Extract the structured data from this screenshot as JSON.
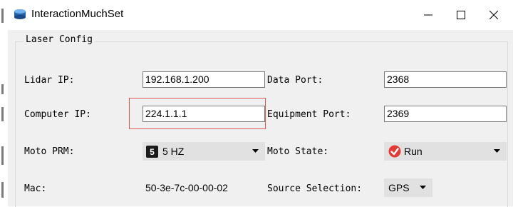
{
  "window": {
    "title": "InteractionMuchSet",
    "controls": [
      "minimize",
      "maximize",
      "close"
    ]
  },
  "group": {
    "title": "Laser Config"
  },
  "fields": {
    "lidar_ip": {
      "label": "Lidar IP:",
      "value": "192.168.1.200"
    },
    "data_port": {
      "label": "Data Port:",
      "value": "2368"
    },
    "computer_ip": {
      "label": "Computer IP:",
      "value": "224.1.1.1"
    },
    "equipment_port": {
      "label": "Equipment Port:",
      "value": "2369"
    },
    "moto_prm": {
      "label": "Moto PRM:",
      "badge": "5",
      "value": "5 HZ"
    },
    "moto_state": {
      "label": "Moto State:",
      "value": "Run"
    },
    "mac": {
      "label": "Mac:",
      "value": "50-3e-7c-00-00-02"
    },
    "source_selection": {
      "label": "Source Selection:",
      "value": "GPS"
    }
  },
  "colors": {
    "highlight_border": "#e05454",
    "run_icon": "#e53935",
    "window_bg": "#f0f0f0"
  }
}
